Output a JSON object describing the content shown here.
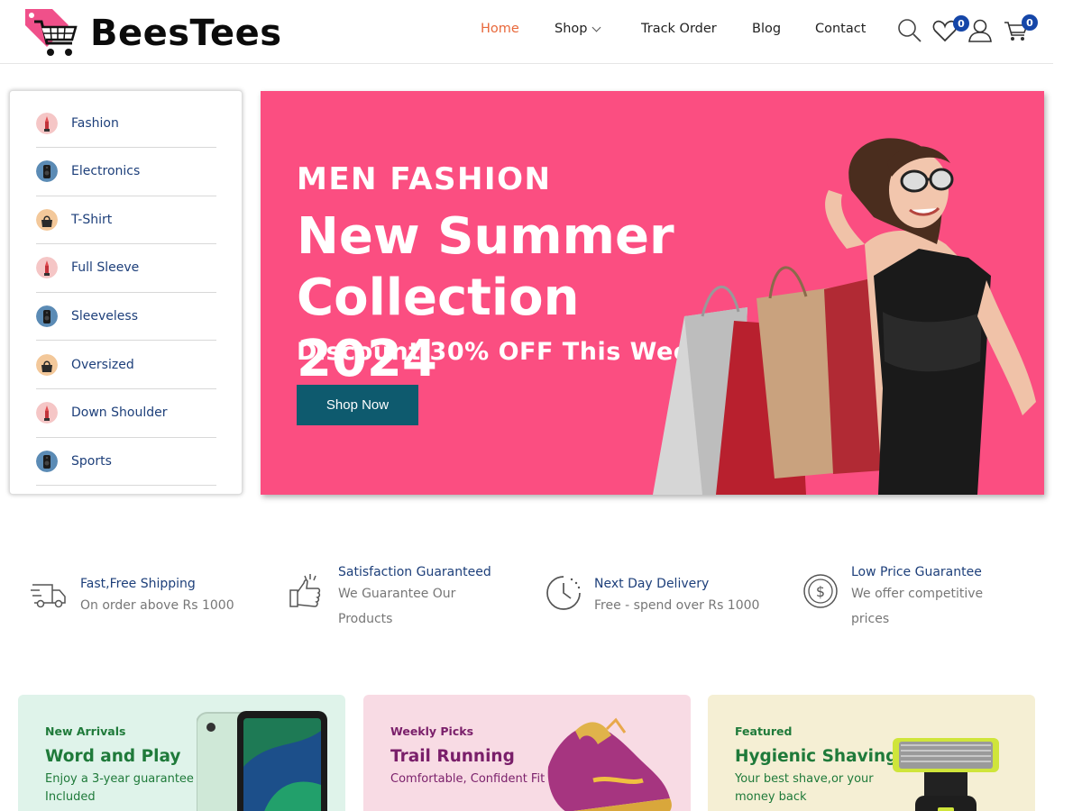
{
  "brand": {
    "name": "BeesTees"
  },
  "nav": {
    "items": [
      "Home",
      "Shop",
      "Track Order",
      "Blog",
      "Contact"
    ],
    "active": "Home"
  },
  "header": {
    "wishlist_count": "0",
    "cart_count": "0"
  },
  "categories": [
    {
      "label": "Fashion",
      "thumb": "lipstick"
    },
    {
      "label": "Electronics",
      "thumb": "speaker"
    },
    {
      "label": "T-Shirt",
      "thumb": "bag"
    },
    {
      "label": "Full Sleeve",
      "thumb": "lipstick"
    },
    {
      "label": "Sleeveless",
      "thumb": "speaker"
    },
    {
      "label": "Oversized",
      "thumb": "bag"
    },
    {
      "label": "Down Shoulder",
      "thumb": "lipstick"
    },
    {
      "label": "Sports",
      "thumb": "speaker"
    }
  ],
  "hero": {
    "eyebrow": "MEN FASHION",
    "title": "New Summer Collection 2024",
    "subtitle": "Discount 30% OFF This Week",
    "cta": "Shop Now"
  },
  "features": [
    {
      "icon": "truck-icon",
      "title": "Fast,Free Shipping",
      "desc": "On order above Rs 1000"
    },
    {
      "icon": "thumbs-up-icon",
      "title": "Satisfaction Guaranteed",
      "desc": "We Guarantee Our Products"
    },
    {
      "icon": "clock-icon",
      "title": "Next Day Delivery",
      "desc": "Free - spend over Rs 1000"
    },
    {
      "icon": "dollar-coin-icon",
      "title": "Low Price Guarantee",
      "desc": "We offer competitive prices"
    }
  ],
  "promos": [
    {
      "eyebrow": "New Arrivals",
      "title": "Word and Play",
      "desc": "Enjoy a 3-year guarantee Included"
    },
    {
      "eyebrow": "Weekly Picks",
      "title": "Trail Running",
      "desc": "Comfortable, Confident Fit"
    },
    {
      "eyebrow": "Featured",
      "title": "Hygienic Shaving",
      "desc": "Your best shave,or your money back"
    }
  ],
  "colors": {
    "hero_bg": "#fb4e81",
    "accent_active": "#e8683a",
    "button": "#0e5a6e",
    "link_blue": "#1d3f7a",
    "badge": "#1546a8"
  }
}
